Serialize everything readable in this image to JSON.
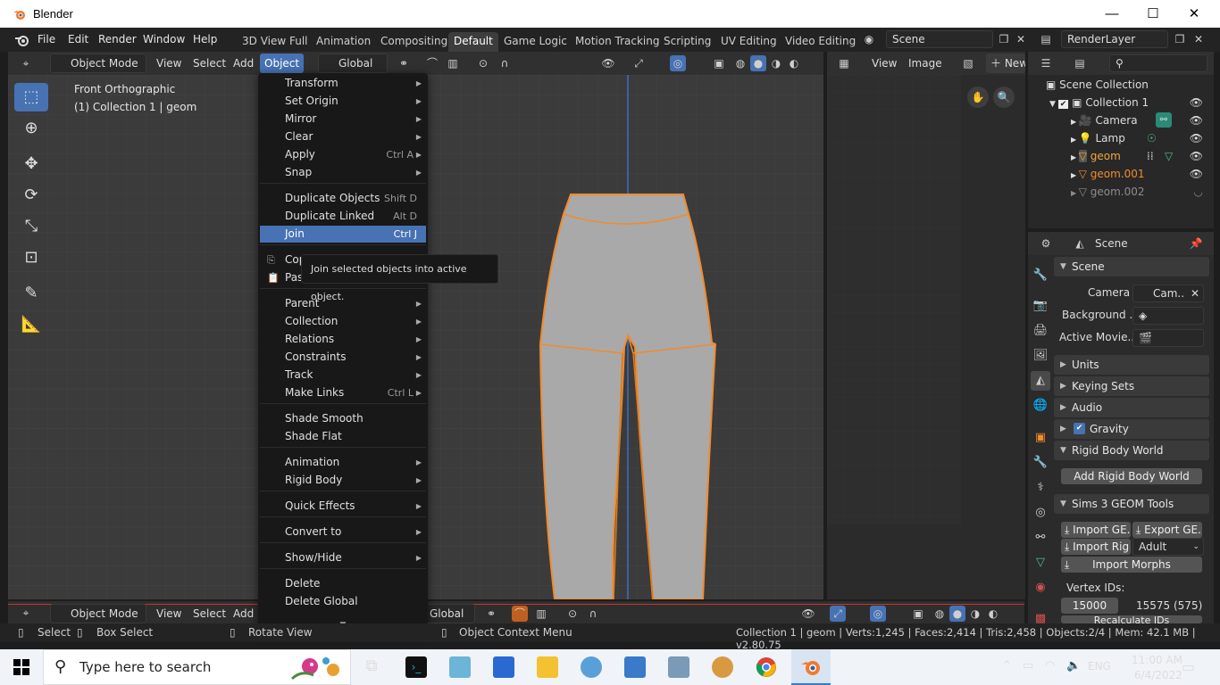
{
  "window": {
    "title": "Blender"
  },
  "menubar": [
    "File",
    "Edit",
    "Render",
    "Window",
    "Help"
  ],
  "workspaces": [
    "3D View Full",
    "Animation",
    "Compositing",
    "Default",
    "Game Logic",
    "Motion Tracking",
    "Scripting",
    "UV Editing",
    "Video Editing"
  ],
  "scene_field": "Scene",
  "renderlayer_field": "RenderLayer",
  "viewport_header": {
    "mode": "Object Mode",
    "view": "View",
    "select": "Select",
    "add": "Add",
    "object": "Object",
    "orientation": "Global"
  },
  "viewport": {
    "view_name": "Front Orthographic",
    "collection": "(1) Collection 1 | geom"
  },
  "object_menu": {
    "items": [
      {
        "label": "Transform",
        "shortcut": "",
        "sub": true
      },
      {
        "label": "Set Origin",
        "shortcut": "",
        "sub": true
      },
      {
        "label": "Mirror",
        "shortcut": "",
        "sub": true
      },
      {
        "label": "Clear",
        "shortcut": "",
        "sub": true
      },
      {
        "label": "Apply",
        "shortcut": "Ctrl A",
        "sub": true
      },
      {
        "label": "Snap",
        "shortcut": "",
        "sub": true
      },
      {
        "label": "Duplicate Objects",
        "shortcut": "Shift D",
        "sub": false
      },
      {
        "label": "Duplicate Linked",
        "shortcut": "Alt D",
        "sub": false
      },
      {
        "label": "Join",
        "shortcut": "Ctrl J",
        "sub": false
      },
      {
        "label": "Copy Objects",
        "shortcut": "",
        "sub": false
      },
      {
        "label": "Paste Objects",
        "shortcut": "",
        "sub": false
      },
      {
        "label": "Parent",
        "shortcut": "",
        "sub": true
      },
      {
        "label": "Collection",
        "shortcut": "",
        "sub": true
      },
      {
        "label": "Relations",
        "shortcut": "",
        "sub": true
      },
      {
        "label": "Constraints",
        "shortcut": "",
        "sub": true
      },
      {
        "label": "Track",
        "shortcut": "",
        "sub": true
      },
      {
        "label": "Make Links",
        "shortcut": "Ctrl L",
        "sub": true
      },
      {
        "label": "Shade Smooth",
        "shortcut": "",
        "sub": false
      },
      {
        "label": "Shade Flat",
        "shortcut": "",
        "sub": false
      },
      {
        "label": "Animation",
        "shortcut": "",
        "sub": true
      },
      {
        "label": "Rigid Body",
        "shortcut": "",
        "sub": true
      },
      {
        "label": "Quick Effects",
        "shortcut": "",
        "sub": true
      },
      {
        "label": "Convert to",
        "shortcut": "",
        "sub": true
      },
      {
        "label": "Show/Hide",
        "shortcut": "",
        "sub": true
      },
      {
        "label": "Delete",
        "shortcut": "",
        "sub": false
      },
      {
        "label": "Delete Global",
        "shortcut": "",
        "sub": false
      }
    ],
    "more_arrow": "▼"
  },
  "tooltip": "Join selected objects into active object.",
  "image_editor": {
    "view": "View",
    "image": "Image",
    "new": "New"
  },
  "outliner": {
    "rows": [
      {
        "label": "Scene Collection",
        "color": "#dddddd"
      },
      {
        "label": "Collection 1",
        "color": "#dddddd"
      },
      {
        "label": "Camera",
        "color": "#dddddd"
      },
      {
        "label": "Lamp",
        "color": "#dddddd"
      },
      {
        "label": "geom",
        "color": "#f5a53b"
      },
      {
        "label": "geom.001",
        "color": "#f08c2c"
      },
      {
        "label": "geom.002",
        "color": "#8c8c8c"
      }
    ]
  },
  "properties": {
    "context": "Scene",
    "scene_panel": "Scene",
    "camera_label": "Camera",
    "camera_value": "Cam..",
    "background_label": "Background ..",
    "active_movie_label": "Active Movie..",
    "units": "Units",
    "keying_sets": "Keying Sets",
    "audio": "Audio",
    "gravity": "Gravity",
    "rigid_body_world": "Rigid Body World",
    "add_rigid_body_world": "Add Rigid Body World",
    "sims3": "Sims 3 GEOM Tools",
    "import_geom": "Import GE..",
    "export_geom": "Export GE..",
    "import_rig": "Import Rig",
    "rig_option": "Adult",
    "import_morphs": "Import Morphs",
    "vertex_ids": "Vertex IDs:",
    "vid_start": "15000",
    "vid_range": "15575 (575)",
    "recalculate": "Recalculate IDs"
  },
  "bottom_header": {
    "mode": "Object Mode",
    "view": "View",
    "select": "Select",
    "add": "Add",
    "orientation": "Global"
  },
  "statusbar": {
    "select": "Select",
    "box_select": "Box Select",
    "rotate_view": "Rotate View",
    "context_menu": "Object Context Menu",
    "stats": "Collection 1 | geom | Verts:1,245 | Faces:2,414 | Tris:2,458 | Objects:2/4 | Mem: 42.1 MB | v2.80.75"
  },
  "taskbar": {
    "search_placeholder": "Type here to search",
    "lang": "ENG",
    "time": "11:00 AM",
    "date": "6/4/2022"
  },
  "colors": {
    "accent": "#4772b3",
    "selection_outline": "#f08c2c",
    "active_object": "#f5a53b"
  }
}
